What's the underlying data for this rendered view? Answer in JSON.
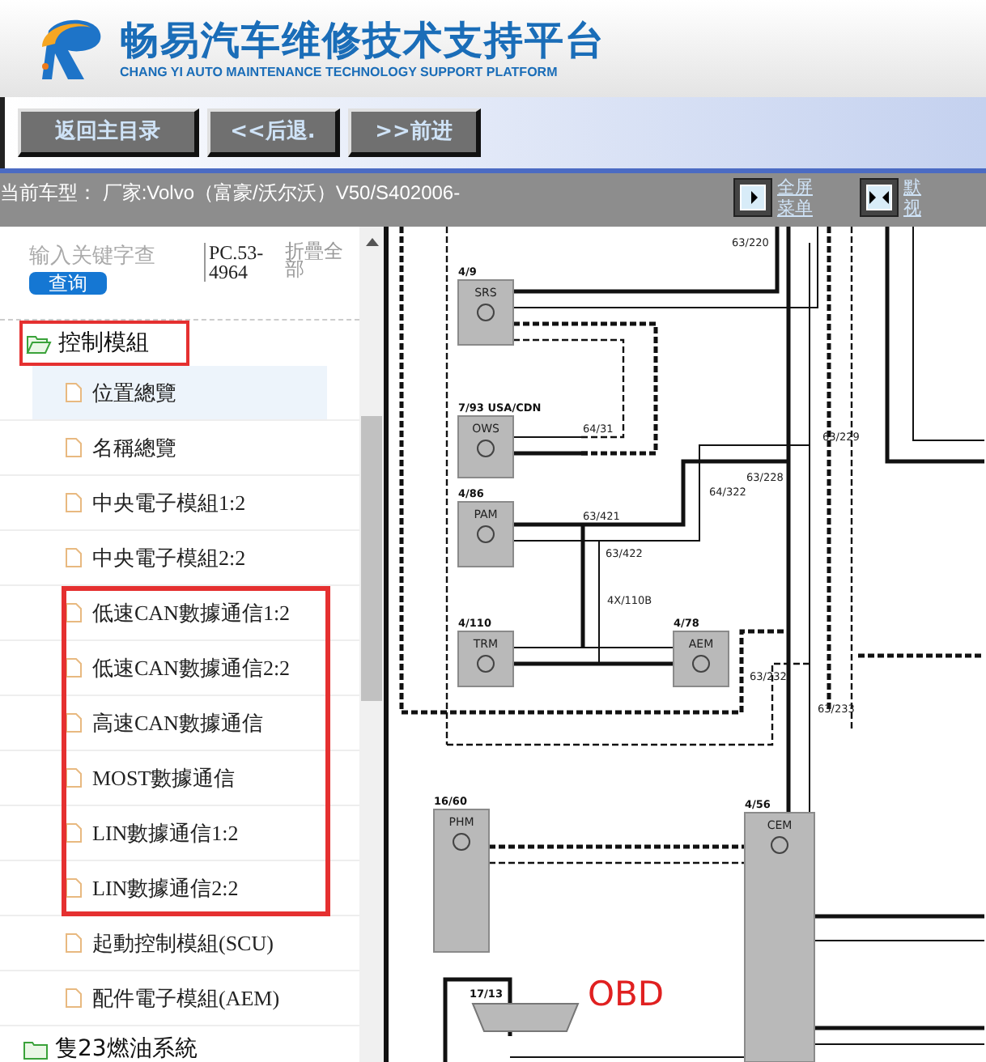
{
  "header": {
    "title": "畅易汽车维修技术支持平台",
    "subtitle": "CHANG YI AUTO MAINTENANCE TECHNOLOGY SUPPORT PLATFORM"
  },
  "nav_buttons": [
    "返回主目录",
    "<<后退.",
    ">>前进"
  ],
  "status_bar": {
    "vehicle": "当前车型： 厂家:Volvo（富豪/沃尔沃）V50/S402006-",
    "actions": [
      {
        "kind": "expand",
        "line_1": "全屏",
        "line_2": "菜单"
      },
      {
        "kind": "split",
        "line_1": "默",
        "line_2": "视"
      }
    ]
  },
  "sidebar": {
    "search": {
      "placeholder": "输入关键字查",
      "button": "查询"
    },
    "code": "PC.53-4964",
    "collapse_all": "折疊全部",
    "tree": [
      {
        "label": "控制模組",
        "expanded": true,
        "highlighted": true,
        "children": [
          {
            "label": "位置總覽",
            "selected": true,
            "highlighted": false
          },
          {
            "label": "名稱總覽",
            "selected": false,
            "highlighted": false
          },
          {
            "label": "中央電子模組1:2",
            "selected": false,
            "highlighted": false
          },
          {
            "label": "中央電子模組2:2",
            "selected": false,
            "highlighted": false
          },
          {
            "label": "低速CAN數據通信1:2",
            "selected": false,
            "highlighted": true
          },
          {
            "label": "低速CAN數據通信2:2",
            "selected": false,
            "highlighted": true
          },
          {
            "label": "高速CAN數據通信",
            "selected": false,
            "highlighted": true
          },
          {
            "label": "MOST數據通信",
            "selected": false,
            "highlighted": true
          },
          {
            "label": "LIN數據通信1:2",
            "selected": false,
            "highlighted": true
          },
          {
            "label": "LIN數據通信2:2",
            "selected": false,
            "highlighted": true
          },
          {
            "label": "起動控制模組(SCU)",
            "selected": false,
            "highlighted": false
          },
          {
            "label": "配件電子模組(AEM)",
            "selected": false,
            "highlighted": false
          }
        ]
      },
      {
        "label": "隻23燃油系統",
        "expanded": false,
        "highlighted": false
      }
    ]
  },
  "diagram": {
    "modules": [
      {
        "code": "4/9",
        "name": "SRS"
      },
      {
        "code": "7/93 USA/CDN",
        "name": "OWS"
      },
      {
        "code": "4/86",
        "name": "PAM"
      },
      {
        "code": "4/110",
        "name": "TRM"
      },
      {
        "code": "4/78",
        "name": "AEM"
      },
      {
        "code": "16/60",
        "name": "PHM"
      },
      {
        "code": "4/56",
        "name": "CEM"
      }
    ],
    "junctions": [
      "63/220",
      "64/31",
      "63/229",
      "63/228",
      "64/322",
      "63/421",
      "63/422",
      "4X/110B",
      "63/232",
      "63/233"
    ],
    "connector_code": "17/13",
    "annotation": "OBD"
  }
}
